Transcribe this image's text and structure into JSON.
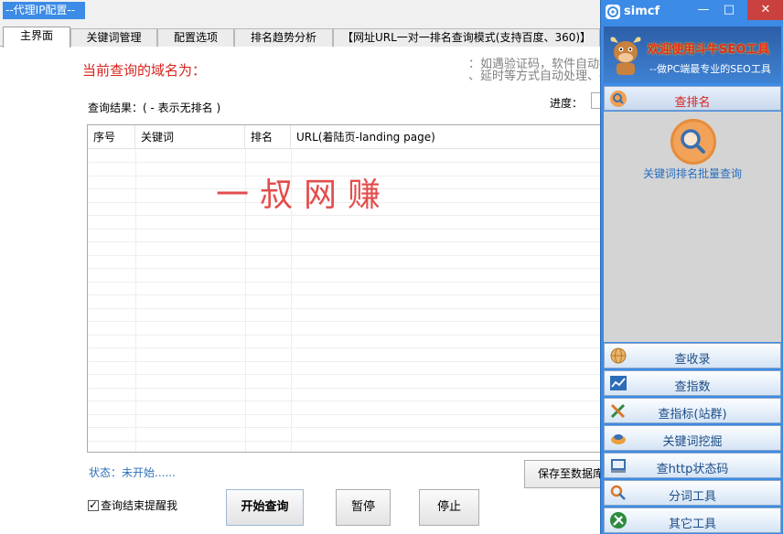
{
  "main": {
    "proxy_tag": "--代理IP配置--",
    "tabs": [
      {
        "label": "主界面",
        "active": true
      },
      {
        "label": "关键词管理",
        "active": false
      },
      {
        "label": "配置选项",
        "active": false
      },
      {
        "label": "排名趋势分析",
        "active": false
      },
      {
        "label": "【网址URL一对一排名查询模式(支持百度、360)】",
        "active": false
      }
    ],
    "domain_label": "当前查询的域名为：",
    "hint_line1": "：如遇验证码，软件自动操",
    "hint_line2": "、延时等方式自动处理、确",
    "result_label": "查询结果：( - 表示无排名 )",
    "progress_label": "进度：",
    "table": {
      "columns": [
        "序号",
        "关键词",
        "排名",
        "URL(着陆页-landing page)"
      ],
      "rows": []
    },
    "watermark": "一叔网赚",
    "status": "状态：未开始......",
    "save_button": "保存至数据库",
    "remind_checkbox": {
      "label": "查询结束提醒我",
      "checked": true
    },
    "buttons": {
      "start": "开始查询",
      "pause": "暂停",
      "stop": "停止"
    }
  },
  "side": {
    "app_name": "simcf",
    "window_controls": {
      "minimize": "—",
      "maximize": "□",
      "close": "✕"
    },
    "banner_title": "欢迎使用斗牛SEO工具",
    "banner_subtitle": "--做PC端最专业的SEO工具",
    "rank_section": {
      "label": "查排名",
      "item_label": "关键词排名批量查询"
    },
    "nav": [
      {
        "label": "查收录",
        "icon": "globe-icon"
      },
      {
        "label": "查指数",
        "icon": "trend-chart-icon"
      },
      {
        "label": "查指标(站群)",
        "icon": "tools-icon"
      },
      {
        "label": "关键词挖掘",
        "icon": "mining-icon"
      },
      {
        "label": "查http状态码",
        "icon": "http-icon"
      },
      {
        "label": "分词工具",
        "icon": "segment-icon"
      },
      {
        "label": "其它工具",
        "icon": "wrench-icon"
      }
    ],
    "colors": {
      "accent": "#3c8be6",
      "highlight_red": "#d8231d",
      "link_blue": "#2a6fc0"
    }
  }
}
